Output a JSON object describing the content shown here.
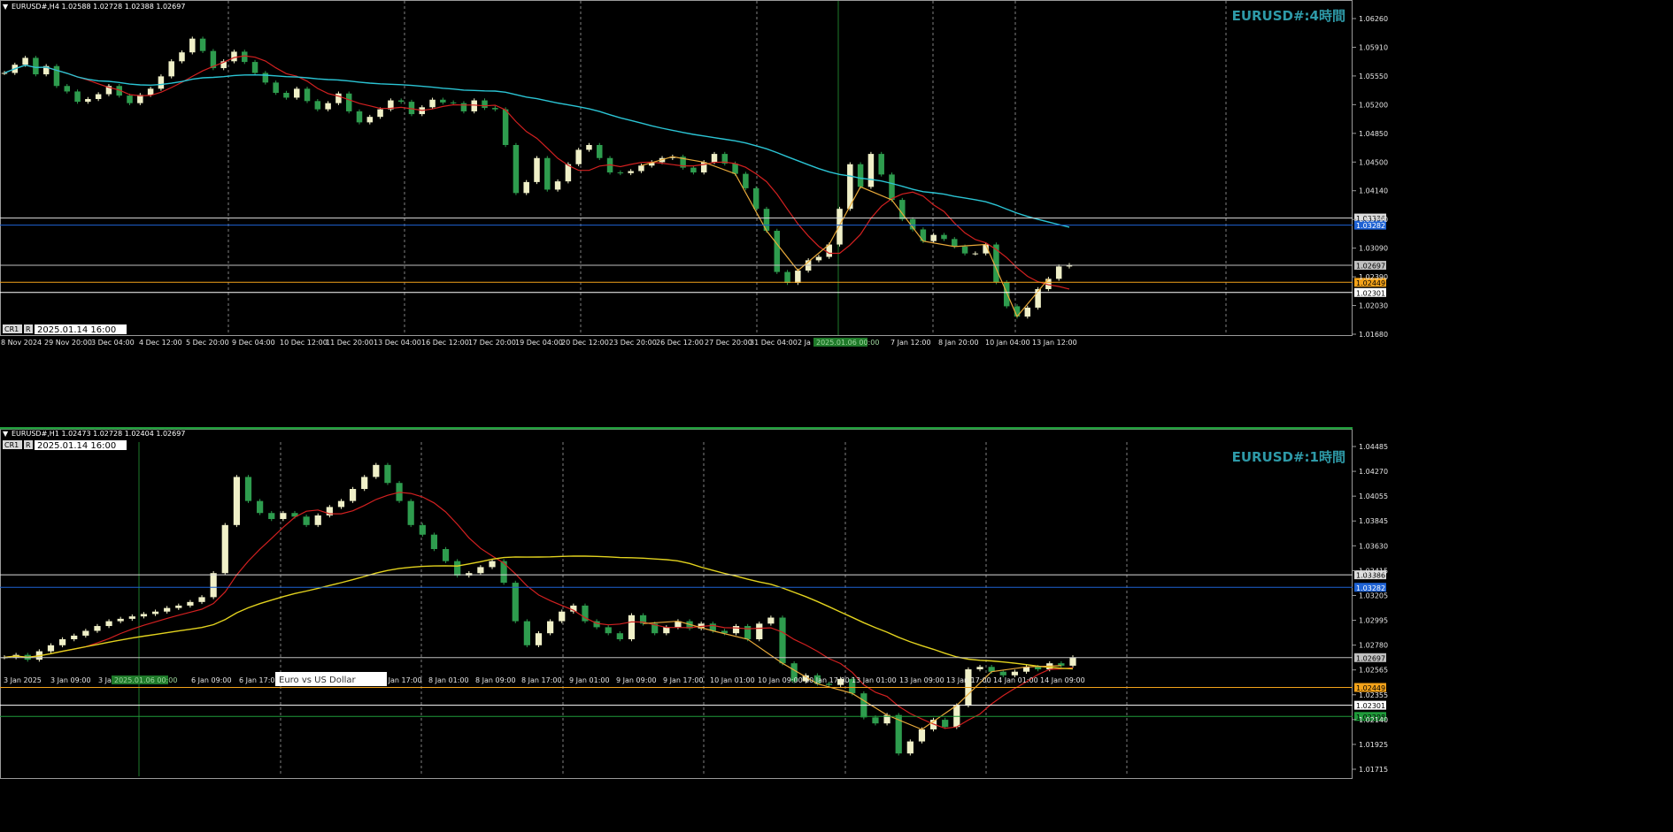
{
  "panes": [
    {
      "info_line": "EURUSD#,H4  1.02588 1.02728 1.02388 1.02697",
      "watermark": "EURUSD#:4時間",
      "badges": [
        "CR1",
        "R"
      ],
      "datetime_box": "2025.01.14 16:00",
      "price_labels": [
        "1.06260",
        "1.05910",
        "1.05550",
        "1.05200",
        "1.04850",
        "1.04500",
        "1.04140",
        "1.03790",
        "1.03090",
        "1.02390",
        "1.02030",
        "1.01680"
      ],
      "time_labels": [
        "8 Nov 2024",
        "29 Nov 20:00",
        "3 Dec 04:00",
        "4 Dec 12:00",
        "5 Dec 20:00",
        "9 Dec 04:00",
        "10 Dec 12:00",
        "11 Dec 20:00",
        "13 Dec 04:00",
        "16 Dec 12:00",
        "17 Dec 20:00",
        "19 Dec 04:00",
        "20 Dec 12:00",
        "23 Dec 20:00",
        "26 Dec 12:00",
        "27 Dec 20:00",
        "31 Dec 04:00",
        "2 Ja",
        "00:00",
        "7 Jan 12:00",
        "8 Jan 20:00",
        "10 Jan 04:00",
        "13 Jan 12:00"
      ],
      "cursor_time_tag": "2025.01.06 00:00",
      "levels": [
        {
          "label": "1.03386",
          "value": 1.03386,
          "color": "#dcdcdc",
          "text_color": "#000000"
        },
        {
          "label": "1.03282",
          "value": 1.03282,
          "color": "#1e62d4",
          "text_color": "#ffffff"
        },
        {
          "label": "1.02697",
          "value": 1.02697,
          "color": "#c0c0c0",
          "text_color": "#000000"
        },
        {
          "label": "1.02449",
          "value": 1.02449,
          "color": "#f3a21a",
          "text_color": "#000000"
        },
        {
          "label": "1.02301",
          "value": 1.02301,
          "color": "#ffffff",
          "text_color": "#000000"
        }
      ]
    },
    {
      "info_line": "EURUSD#,H1  1.02473 1.02728 1.02404 1.02697",
      "watermark": "EURUSD#:1時間",
      "badges": [
        "CR1",
        "R"
      ],
      "datetime_box": "2025.01.14 16:00",
      "price_labels": [
        "1.04485",
        "1.04270",
        "1.04055",
        "1.03845",
        "1.03630",
        "1.03415",
        "1.03205",
        "1.02995",
        "1.02780",
        "1.02565",
        "1.02355",
        "1.02140",
        "1.01925",
        "1.01715"
      ],
      "time_labels": [
        "3 Jan 2025",
        "3 Jan 09:00",
        "3 Ja",
        "00",
        "6 Jan 09:00",
        "6 Jan 17:00",
        "7 Jan 17:00",
        "8 Jan 01:00",
        "8 Jan 09:00",
        "8 Jan 17:00",
        "9 Jan 01:00",
        "9 Jan 09:00",
        "9 Jan 17:00",
        "10 Jan 01:00",
        "10 Jan 09:00",
        "10 Jan 17:00",
        "13 Jan 01:00",
        "13 Jan 09:00",
        "13 Jan 17:00",
        "14 Jan 01:00",
        "14 Jan 09:00"
      ],
      "cursor_time_tag": "2025.01.06 00:00",
      "tooltip": "Euro vs US Dollar",
      "levels": [
        {
          "label": "1.03386",
          "value": 1.03386,
          "color": "#dcdcdc",
          "text_color": "#000000"
        },
        {
          "label": "1.03282",
          "value": 1.03282,
          "color": "#1e62d4",
          "text_color": "#ffffff"
        },
        {
          "label": "1.02697",
          "value": 1.02697,
          "color": "#c0c0c0",
          "text_color": "#000000"
        },
        {
          "label": "1.02449",
          "value": 1.02449,
          "color": "#f3a21a",
          "text_color": "#000000"
        },
        {
          "label": "1.02301",
          "value": 1.02301,
          "color": "#ffffff",
          "text_color": "#000000"
        },
        {
          "label": "1.02208",
          "value": 1.02208,
          "color": "#1f9a3a",
          "text_color": "#000000"
        }
      ]
    }
  ],
  "colors": {
    "background": "#000000",
    "grid": "#7f7f7f",
    "bull_candle": "#f0f0c8",
    "bear_candle": "#2e9c4e",
    "ma_fast": "#d22020",
    "ma_slow_h4": "#2bc4d4",
    "ma_slow_h1": "#e2d21e",
    "zigzag": "#e8a93a",
    "watermark": "#2e9aa8",
    "cursor_line": "#1e7a2a"
  },
  "chart_data": [
    {
      "type": "candlestick",
      "title": "EURUSD#,H4",
      "ylim": [
        1.0168,
        1.0655
      ],
      "close_series": [
        1.055,
        1.0562,
        1.0572,
        1.0548,
        1.056,
        1.0531,
        1.0523,
        1.0508,
        1.0512,
        1.0519,
        1.0531,
        1.0517,
        1.0506,
        1.0518,
        1.0527,
        1.0545,
        1.0567,
        1.058,
        1.06,
        1.0582,
        1.0557,
        1.0567,
        1.0581,
        1.0566,
        1.055,
        1.0536,
        1.0521,
        1.0514,
        1.0527,
        1.0509,
        1.0497,
        1.0506,
        1.052,
        1.0494,
        1.0478,
        1.0486,
        1.0497,
        1.051,
        1.0508,
        1.049,
        1.05,
        1.0511,
        1.0507,
        1.0506,
        1.0494,
        1.051,
        1.0499,
        1.0497,
        1.0445,
        1.0375,
        1.0391,
        1.0426,
        1.038,
        1.0392,
        1.0417,
        1.0438,
        1.0445,
        1.0426,
        1.0405,
        1.0404,
        1.0407,
        1.0415,
        1.042,
        1.0426,
        1.0428,
        1.0412,
        1.0405,
        1.042,
        1.0432,
        1.0418,
        1.0403,
        1.0382,
        1.0352,
        1.032,
        1.026,
        1.0244,
        1.0262,
        1.0277,
        1.0282,
        1.03,
        1.0352,
        1.0417,
        1.0384,
        1.0432,
        1.0402,
        1.0365,
        1.0337,
        1.0322,
        1.0305,
        1.0314,
        1.0308,
        1.0297,
        1.0287,
        1.0287,
        1.03,
        1.0245,
        1.021,
        1.0195,
        1.0208,
        1.0235,
        1.025,
        1.0268,
        1.027
      ]
    },
    {
      "type": "candlestick",
      "title": "EURUSD#,H1",
      "ylim": [
        1.0171,
        1.0449
      ],
      "close_series": [
        1.027,
        1.0272,
        1.0268,
        1.0275,
        1.028,
        1.0285,
        1.0288,
        1.0292,
        1.0296,
        1.03,
        1.0302,
        1.0304,
        1.0306,
        1.0308,
        1.0311,
        1.0313,
        1.0316,
        1.032,
        1.034,
        1.038,
        1.042,
        1.04,
        1.039,
        1.0385,
        1.039,
        1.0387,
        1.038,
        1.0388,
        1.0395,
        1.04,
        1.041,
        1.042,
        1.043,
        1.0415,
        1.04,
        1.038,
        1.0372,
        1.036,
        1.035,
        1.0338,
        1.034,
        1.0345,
        1.035,
        1.0332,
        1.03,
        1.028,
        1.029,
        1.03,
        1.0308,
        1.0313,
        1.03,
        1.0295,
        1.029,
        1.0285,
        1.0305,
        1.0298,
        1.029,
        1.0295,
        1.03,
        1.0294,
        1.0298,
        1.0292,
        1.029,
        1.0296,
        1.0285,
        1.0298,
        1.0303,
        1.0265,
        1.025,
        1.0255,
        1.0248,
        1.0247,
        1.0252,
        1.024,
        1.022,
        1.0215,
        1.0222,
        1.019,
        1.02,
        1.021,
        1.0218,
        1.0212,
        1.023,
        1.026,
        1.0262,
        1.0258,
        1.0255,
        1.0258,
        1.0262,
        1.026,
        1.0265,
        1.0263,
        1.027
      ]
    }
  ]
}
